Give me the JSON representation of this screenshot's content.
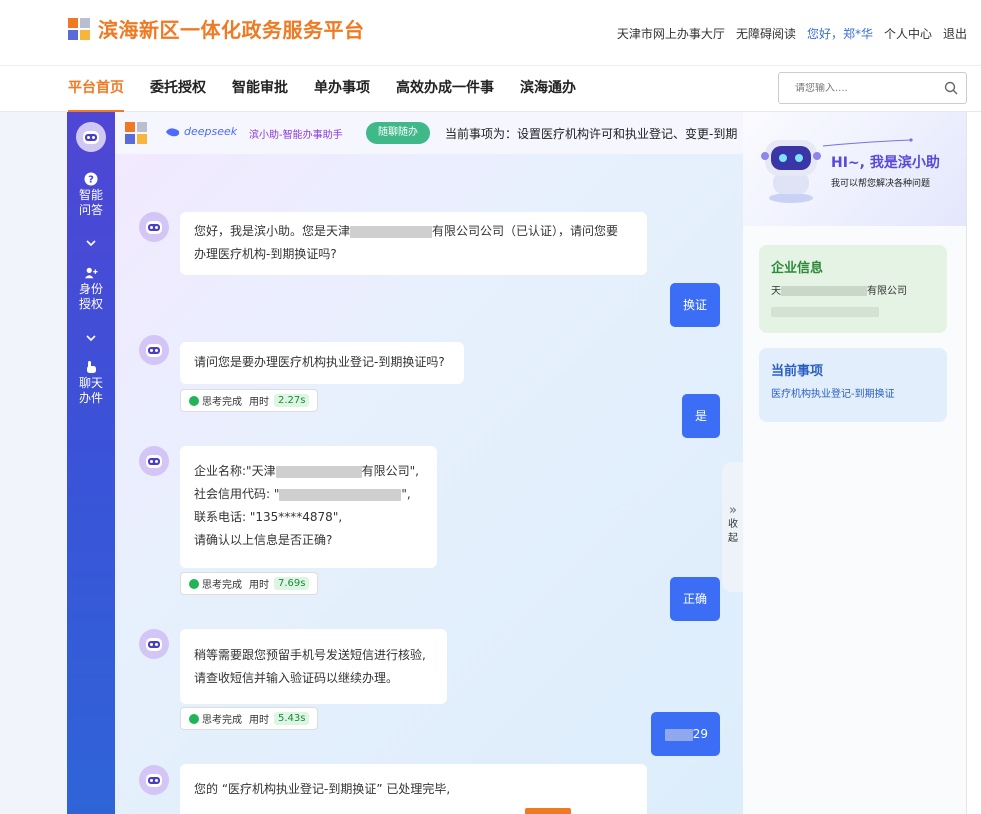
{
  "header": {
    "title": "滨海新区一体化政务服务平台",
    "links": [
      "天津市网上办事大厅",
      "无障碍阅读",
      "您好，郑*华",
      "个人中心",
      "退出"
    ],
    "brand_color": "#f07a23"
  },
  "nav": {
    "items": [
      "平台首页",
      "委托授权",
      "智能审批",
      "单办事项",
      "高效办成一件事",
      "滨海通办"
    ],
    "active_index": 0,
    "search_placeholder": "请您输入....",
    "search_icon": "search-icon"
  },
  "sidebar": {
    "items": [
      {
        "label": "智能问答",
        "icon": "question-icon"
      },
      {
        "label": "身份授权",
        "icon": "user-add-icon"
      },
      {
        "label": "聊天办件",
        "icon": "hand-pointer-icon"
      }
    ]
  },
  "chatbar": {
    "deepseek": "deepseek",
    "assistant_name": "滨小助-智能办事助手",
    "random_button": "随聊随办",
    "current_item": "当前事项为：设置医疗机构许可和执业登记、变更-到期"
  },
  "messages": {
    "m1": {
      "a": "您好，我是滨小助。您是天津",
      "b": "有限公司公司（已认证），请问您要",
      "c": "办理医疗机构-到期换证吗?"
    },
    "u1": "换证",
    "m2": "请问您是要办理医疗机构执业登记-到期换证吗?",
    "t2": {
      "label": "思考完成",
      "used": "用时",
      "time": "2.27s"
    },
    "u2": "是",
    "m3": {
      "l1a": "企业名称:\"天津",
      "l1b": "有限公司\",",
      "l2a": "社会信用代码: \"",
      "l2b": "\",",
      "l3": "联系电话: \"135****4878\",",
      "l4": "请确认以上信息是否正确?"
    },
    "t3": {
      "label": "思考完成",
      "used": "用时",
      "time": "7.69s"
    },
    "u3": "正确",
    "m4": {
      "l1": "稍等需要跟您预留手机号发送短信进行核验,",
      "l2": "请查收短信并输入验证码以继续办理。"
    },
    "t4": {
      "label": "思考完成",
      "used": "用时",
      "time": "5.43s"
    },
    "u4": "29",
    "m5": "您的 “医疗机构执业登记-到期换证” 已处理完毕,"
  },
  "collapse": {
    "label": "收起",
    "arrow": "»"
  },
  "right": {
    "hero_title": "HI~, 我是滨小助",
    "hero_sub": "我可以帮您解决各种问题",
    "company_title": "企业信息",
    "company_prefix": "天",
    "company_suffix": "有限公司",
    "item_title": "当前事项",
    "item_text": "医疗机构执业登记-到期换证"
  }
}
